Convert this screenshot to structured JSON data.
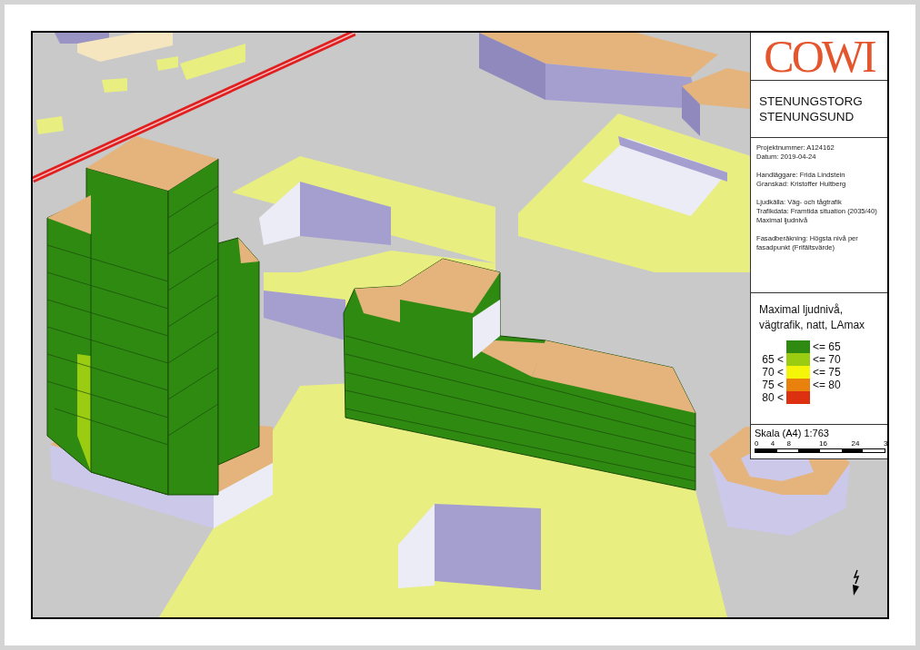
{
  "logo": {
    "text": "COWI"
  },
  "title": [
    "STENUNGSTORG",
    "STENUNGSUND"
  ],
  "info": [
    [
      "Projektnummer: A124162",
      "Datum: 2019-04-24"
    ],
    [
      "Handläggare: Frida Lindstein",
      "Granskad: Kristoffer Hultberg"
    ],
    [
      "Ljudkälla: Väg- och tågtrafik",
      "Trafikdata: Framtida situation (2035/40)",
      "Maximal ljudnivå"
    ],
    [
      "Fasadberäkning: Högsta nivå per fasadpunkt (Frifältsvärde)"
    ]
  ],
  "legend": {
    "title": "Maximal ljudnivå, vägtrafik, natt, LAmax",
    "classes": [
      {
        "upper": "<= 65",
        "color": "#2f8a12"
      },
      {
        "lower": "65 <",
        "upper": "<= 70",
        "color": "#9acd12"
      },
      {
        "lower": "70 <",
        "upper": "<= 75",
        "color": "#f5f50a"
      },
      {
        "lower": "75 <",
        "upper": "<= 80",
        "color": "#e8820c"
      },
      {
        "lower": "80 <",
        "color": "#dc3010"
      }
    ]
  },
  "scale": {
    "label": "Skala (A4) 1:763",
    "ticks": [
      "0",
      "4",
      "8",
      "16",
      "24",
      "3"
    ]
  }
}
